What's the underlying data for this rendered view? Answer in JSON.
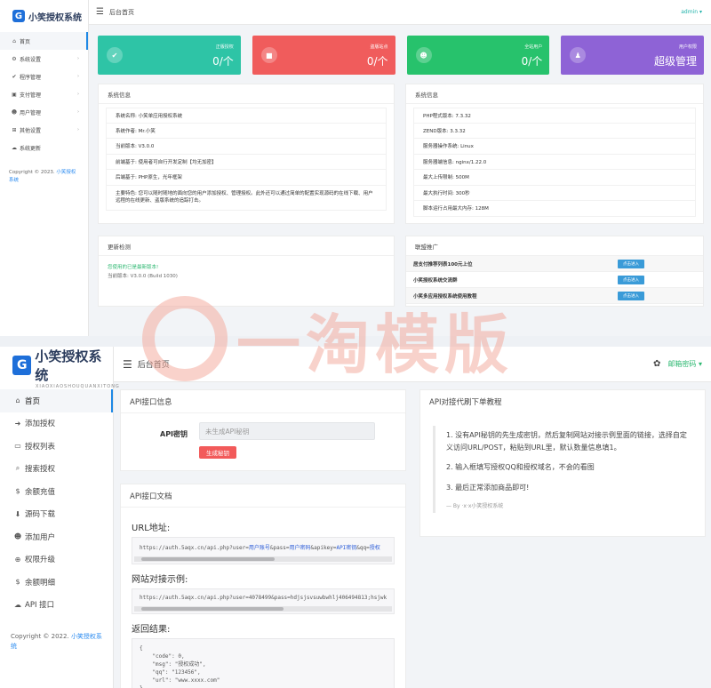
{
  "top": {
    "logo_text": "小笑授权系统",
    "breadcrumb": "后台首页",
    "user": "admin",
    "user_caret": "▾",
    "nav": [
      {
        "label": "首页",
        "icon": "home-icon",
        "glyph": "⌂"
      },
      {
        "label": "系统设置",
        "icon": "gear-icon",
        "glyph": "⚙"
      },
      {
        "label": "程序管理",
        "icon": "check-circle-icon",
        "glyph": "✔"
      },
      {
        "label": "支付管理",
        "icon": "wallet-icon",
        "glyph": "▣"
      },
      {
        "label": "用户管理",
        "icon": "user-icon",
        "glyph": "☻"
      },
      {
        "label": "其他设置",
        "icon": "grid-icon",
        "glyph": "⊞"
      },
      {
        "label": "系统更新",
        "icon": "cloud-icon",
        "glyph": "☁"
      }
    ],
    "copyright_prefix": "Copyright © 2023.",
    "copyright_link": "小笑授权系统",
    "cards": [
      {
        "label": "正版授权",
        "value": "0/个",
        "color": "#2ec4a6",
        "icon": "check-icon",
        "glyph": "✔"
      },
      {
        "label": "盗版站点",
        "value": "0/个",
        "color": "#f05c5c",
        "icon": "trash-icon",
        "glyph": "■"
      },
      {
        "label": "全站用户",
        "value": "0/个",
        "color": "#27c26c",
        "icon": "users-icon",
        "glyph": "☻"
      },
      {
        "label": "用户权限",
        "value": "超级管理",
        "color": "#8e63d6",
        "icon": "person-icon",
        "glyph": "♟"
      }
    ],
    "sys_info_title": "系统信息",
    "sys_info_left": [
      "系统名称:  小笑单应用授权系统",
      "系统作者:  Mr.小笑",
      "当前版本:  V3.0.0",
      "前端基于:  使用者可自行开发定制【均无加密】",
      "后端基于:  PHP原生，光年框架"
    ],
    "sys_info_left_tall": "主要特色:  您可以随时随地的面向您的用户添加授权、管理授权。此外还可以通过简单的配置实现源码的在线下载、用户远程的在线更新、盗版系统的追踪打击。",
    "sys_info_right_title": "系统信息",
    "sys_info_right": [
      "PHP程式版本:  7.3.32",
      "ZEND版本:  3.3.32",
      "服务器操作系统:  Linux",
      "服务器端信息:  nginx/1.22.0",
      "最大上传限制:  500M",
      "最大执行时间:  300秒",
      "脚本运行占用最大内存:  128M"
    ],
    "update_title": "更新检测",
    "update_green": "您使用的已是最新版本!",
    "update_gray": "当前版本: V3.0.0 (Build 1030)",
    "promo_title": "联盟推广",
    "promo": [
      {
        "text": "居支付推荐列表100元上位",
        "btn": "点击进入"
      },
      {
        "text": "小笑授权系统交流群",
        "btn": "点击进入"
      },
      {
        "text": "小笑多应用授权系统使用教程",
        "btn": "点击进入"
      }
    ]
  },
  "bottom": {
    "logo_text": "小笑授权系统",
    "logo_sub": "XIAOXIAOSHOUQUANXITONG",
    "breadcrumb": "后台首页",
    "user": "邮箱密码",
    "user_caret": "▾",
    "nav": [
      {
        "label": "首页",
        "icon": "home-icon",
        "glyph": "⌂"
      },
      {
        "label": "添加授权",
        "icon": "arrow-right-icon",
        "glyph": "➜"
      },
      {
        "label": "授权列表",
        "icon": "monitor-icon",
        "glyph": "▭"
      },
      {
        "label": "搜索授权",
        "icon": "search-icon",
        "glyph": "⌕"
      },
      {
        "label": "余额充值",
        "icon": "dollar-icon",
        "glyph": "$"
      },
      {
        "label": "源码下载",
        "icon": "download-icon",
        "glyph": "⬇"
      },
      {
        "label": "添加用户",
        "icon": "add-user-icon",
        "glyph": "☻"
      },
      {
        "label": "权限升级",
        "icon": "crosshair-icon",
        "glyph": "⊕"
      },
      {
        "label": "余额明细",
        "icon": "dollar-icon",
        "glyph": "$"
      },
      {
        "label": "API 接口",
        "icon": "cloud-icon",
        "glyph": "☁"
      }
    ],
    "copyright_prefix": "Copyright © 2022.",
    "copyright_link": "小笑授权系统",
    "api_info_title": "API接口信息",
    "api_key_label": "API密钥",
    "api_key_placeholder": "未生成API秘钥",
    "api_key_button": "生成秘钥",
    "api_doc_title": "API接口文档",
    "url_heading": "URL地址:",
    "url_code_prefix": "https://auth.5aqx.cn/api.php?user=",
    "url_code_hl1": "用户账号",
    "url_code_mid1": "&pass=",
    "url_code_hl2": "用户密码",
    "url_code_mid2": "&apikey=",
    "url_code_hl3": "API密钥",
    "url_code_mid3": "&qq=",
    "url_code_hl4": "授权",
    "example_heading": "网站对接示例:",
    "example_code": "https://auth.5aqx.cn/api.php?user=4078499&pass=hdjsjsvsuwbwhlj406494813;hsjwk",
    "result_heading": "返回结果:",
    "result_lines": [
      "{",
      "    \"code\": 0,",
      "    \"msg\": \"授权成功\",",
      "    \"qq\": \"123456\",",
      "    \"url\": \"www.xxxx.com\"",
      "}"
    ],
    "guide_title": "API对接代刷下单教程",
    "guide_steps": [
      "1. 没有API秘钥的先生成密钥，然后复制网站对接示例里面的链接，选择自定义访问URL/POST，粘贴到URL里，默认数量信息填1。",
      "2. 输入框填写授权QQ和授权域名，不会的看图",
      "3. 最后正常添加商品即可!"
    ],
    "guide_foot": "— By ·x·x小笑授权系统"
  },
  "watermark": {
    "text": "一淘模版"
  }
}
